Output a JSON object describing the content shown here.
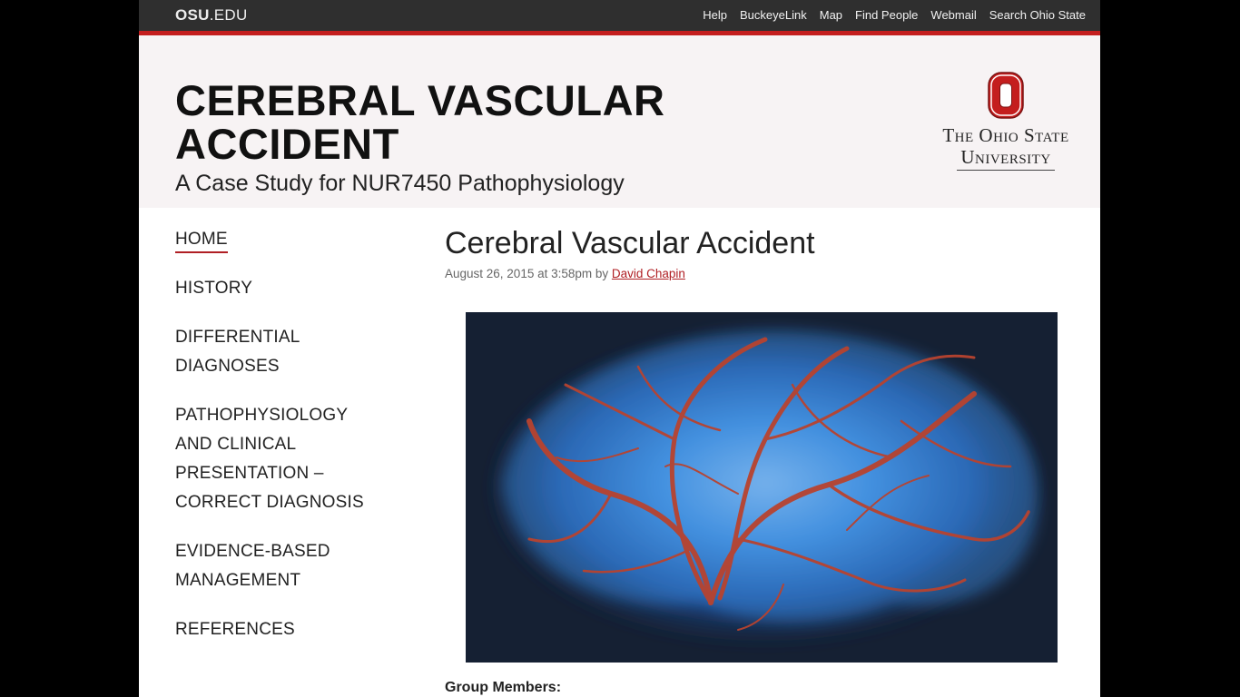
{
  "osu_bar": {
    "logo_bold": "OSU",
    "logo_light": ".EDU",
    "nav": [
      "Help",
      "BuckeyeLink",
      "Map",
      "Find People",
      "Webmail",
      "Search Ohio State"
    ]
  },
  "header": {
    "title_line1": "CEREBRAL VASCULAR",
    "title_line2": "ACCIDENT",
    "subtitle": "A Case Study for NUR7450 Pathophysiology",
    "brand_line1": "The Ohio State",
    "brand_line2": "University",
    "logo_icon": "block-o-icon",
    "brand_color": "#c41e1e"
  },
  "sidebar": {
    "items": [
      {
        "label": "HOME",
        "active": true
      },
      {
        "label": "HISTORY"
      },
      {
        "label": "DIFFERENTIAL DIAGNOSES"
      },
      {
        "label": "PATHOPHYSIOLOGY AND CLINICAL PRESENTATION – CORRECT DIAGNOSIS"
      },
      {
        "label": "EVIDENCE-BASED MANAGEMENT"
      },
      {
        "label": "REFERENCES"
      }
    ]
  },
  "post": {
    "title": "Cerebral Vascular Accident",
    "meta_prefix": "August 26, 2015 at 3:58pm by ",
    "author": "David Chapin",
    "image_subject": "brain-vasculature-image",
    "group_label": "Group Members:"
  }
}
